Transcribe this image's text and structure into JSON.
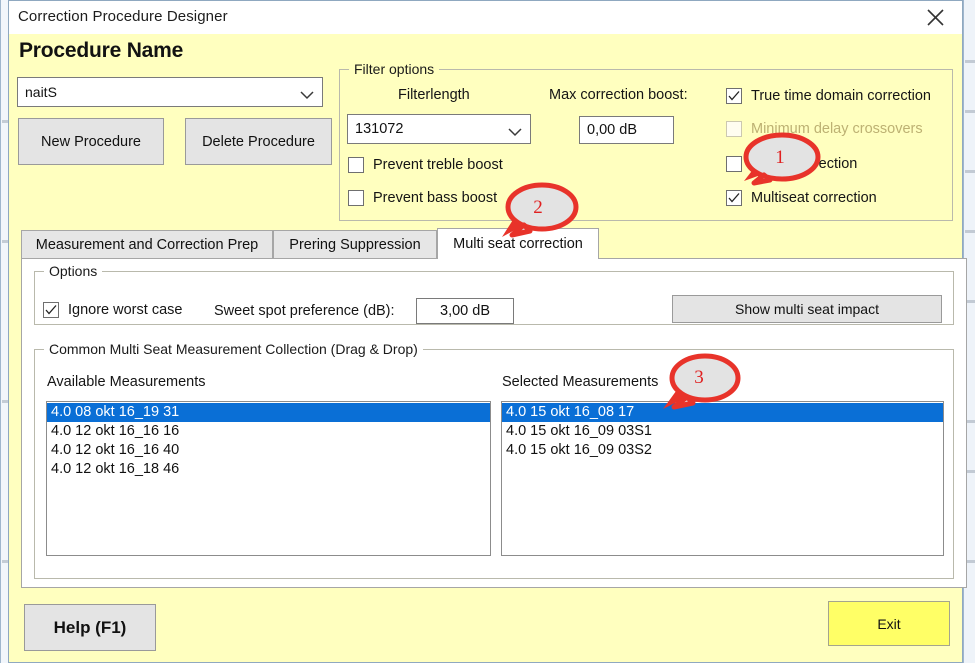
{
  "window": {
    "title": "Correction Procedure Designer",
    "close_icon": "close-icon",
    "background_color": "#FFFFBF"
  },
  "header": {
    "procedure_name_label": "Procedure Name"
  },
  "procedure": {
    "combo_value": "naitS",
    "combo_arrow_icon": "chevron-down-icon",
    "new_button": "New Procedure",
    "delete_button": "Delete Procedure"
  },
  "filter_options": {
    "legend": "Filter options",
    "filterlength_label": "Filterlength",
    "filterlength_value": "131072",
    "filterlength_arrow_icon": "chevron-down-icon",
    "max_boost_label": "Max correction boost:",
    "max_boost_value": "0,00 dB",
    "checkboxes": [
      {
        "label": "Prevent treble boost",
        "checked": false,
        "enabled": true
      },
      {
        "label": "Prevent bass boost",
        "checked": false,
        "enabled": true
      },
      {
        "label": "True time domain correction",
        "checked": true,
        "enabled": true
      },
      {
        "label": "Minimum delay crossovers",
        "checked": false,
        "enabled": false
      },
      {
        "label": "Room correction",
        "checked": false,
        "enabled": true
      },
      {
        "label": "Multiseat correction",
        "checked": true,
        "enabled": true
      }
    ]
  },
  "tabs": [
    {
      "label": "Measurement and Correction Prep",
      "active": false
    },
    {
      "label": "Prering Suppression",
      "active": false
    },
    {
      "label": "Multi seat correction",
      "active": true
    }
  ],
  "options_group": {
    "legend": "Options",
    "ignore_worst_case_label": "Ignore worst case",
    "ignore_worst_case_checked": true,
    "sweet_spot_label": "Sweet spot preference (dB):",
    "sweet_spot_value": "3,00 dB",
    "show_impact_button": "Show multi seat impact"
  },
  "collection_group": {
    "legend": "Common Multi Seat Measurement Collection  (Drag & Drop)",
    "available_label": "Available Measurements",
    "selected_label": "Selected Measurements",
    "available": [
      {
        "text": "4.0 08 okt 16_19 31",
        "selected": true
      },
      {
        "text": "4.0 12 okt 16_16 16",
        "selected": false
      },
      {
        "text": "4.0 12 okt 16_16 40",
        "selected": false
      },
      {
        "text": "4.0 12 okt 16_18 46",
        "selected": false
      }
    ],
    "selected": [
      {
        "text": "4.0 15 okt 16_08 17",
        "selected": true
      },
      {
        "text": "4.0 15 okt 16_09 03S1",
        "selected": false
      },
      {
        "text": "4.0 15 okt 16_09 03S2",
        "selected": false
      }
    ]
  },
  "footer": {
    "help_button": "Help (F1)",
    "exit_button": "Exit",
    "exit_color": "#FFFF66"
  },
  "annotations": {
    "callout_color": "#E8332A",
    "items": [
      {
        "number": "1"
      },
      {
        "number": "2"
      },
      {
        "number": "3"
      }
    ]
  }
}
